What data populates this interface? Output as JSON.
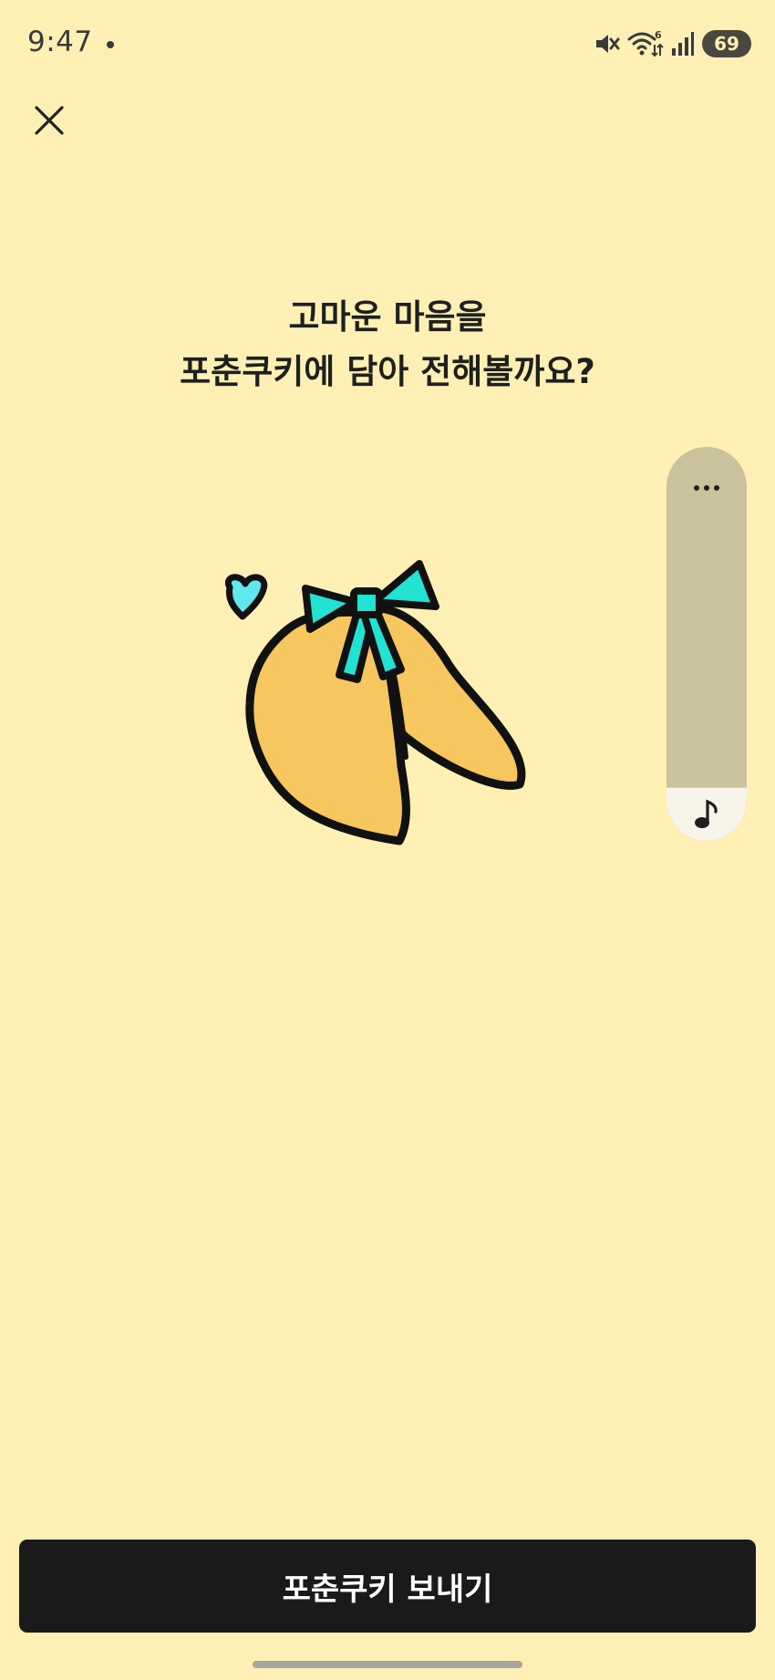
{
  "status_bar": {
    "time": "9:47",
    "battery": "69",
    "wifi_badge": "6",
    "icons": [
      "mute-icon",
      "wifi-icon",
      "signal-icon",
      "battery-icon"
    ]
  },
  "header": {
    "close_icon": "close-icon"
  },
  "main": {
    "headline_line1": "고마운 마음을",
    "headline_line2": "포춘쿠키에 담아 전해볼까요?",
    "illustration": "fortune-cookie-illustration"
  },
  "side_panel": {
    "more_icon": "more-icon",
    "music_icon": "music-note-icon"
  },
  "footer": {
    "send_label": "포춘쿠키 보내기"
  },
  "colors": {
    "background": "#fef0b4",
    "button": "#1a1a1a",
    "cookie": "#f7c75f",
    "ribbon": "#22e3d3",
    "panel": "#c9c29c"
  }
}
